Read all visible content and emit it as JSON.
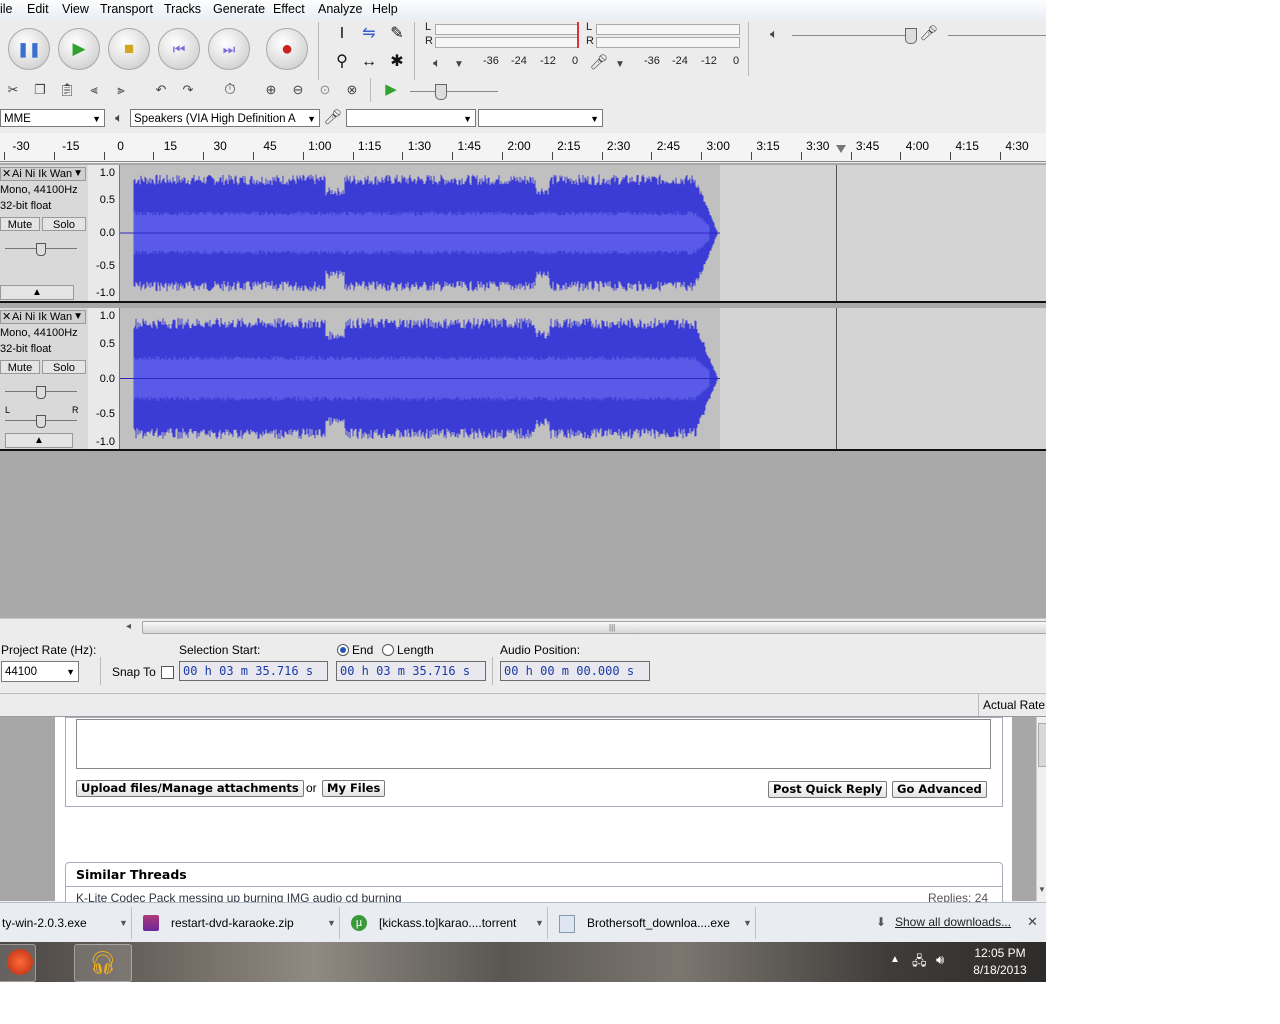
{
  "menu": [
    "ile",
    "Edit",
    "View",
    "Transport",
    "Tracks",
    "Generate",
    "Effect",
    "Analyze",
    "Help"
  ],
  "transport": {
    "buttons": [
      {
        "name": "pause-button",
        "icon": "pause-icon"
      },
      {
        "name": "play-button",
        "icon": "play-icon"
      },
      {
        "name": "stop-button",
        "icon": "stop-icon"
      },
      {
        "name": "skip-start-button",
        "icon": "skip-start-icon"
      },
      {
        "name": "skip-end-button",
        "icon": "skip-end-icon"
      },
      {
        "name": "record-button",
        "icon": "record-icon"
      }
    ]
  },
  "meters": {
    "playback_ticks": [
      "-36",
      "-24",
      "-12",
      "0"
    ],
    "record_ticks": [
      "-36",
      "-24",
      "-12",
      "0"
    ],
    "channel_l": "L",
    "channel_r": "R"
  },
  "devices": {
    "host": "MME",
    "output": "Speakers (VIA High Definition A",
    "input": "",
    "channels": ""
  },
  "timeline": {
    "ticks": [
      "-30",
      "-15",
      "0",
      "15",
      "30",
      "45",
      "1:00",
      "1:15",
      "1:30",
      "1:45",
      "2:00",
      "2:15",
      "2:30",
      "2:45",
      "3:00",
      "3:15",
      "3:30",
      "3:45",
      "4:00",
      "4:15",
      "4:30"
    ]
  },
  "tracks": [
    {
      "name": "Ai Ni Ik Wan",
      "format": "Mono, 44100Hz",
      "bits": "32-bit float",
      "mute": "Mute",
      "solo": "Solo",
      "scale": [
        "1.0",
        "0.5",
        "0.0",
        "-0.5",
        "-1.0"
      ]
    },
    {
      "name": "Ai Ni Ik Wan",
      "format": "Mono, 44100Hz",
      "bits": "32-bit float",
      "mute": "Mute",
      "solo": "Solo",
      "scale": [
        "1.0",
        "0.5",
        "0.0",
        "-0.5",
        "-1.0"
      ],
      "pan_left": "L",
      "pan_right": "R"
    }
  ],
  "selection": {
    "project_rate_label": "Project Rate (Hz):",
    "project_rate": "44100",
    "snap_to": "Snap To",
    "selection_start_label": "Selection Start:",
    "end_label": "End",
    "length_label": "Length",
    "audio_position_label": "Audio Position:",
    "start_value": "00 h 03 m 35.716 s",
    "end_value": "00 h 03 m 35.716 s",
    "position_value": "00 h 00 m 00.000 s",
    "end_selected": true
  },
  "status": {
    "actual_rate": "Actual Rate:"
  },
  "forum": {
    "upload_button": "Upload files/Manage attachments",
    "or": "or",
    "my_files": "My Files",
    "post_quick_reply": "Post Quick Reply",
    "go_advanced": "Go Advanced",
    "similar_threads": "Similar Threads",
    "thread_title": "K-Lite Codec Pack messing up burning IMG audio cd burning",
    "replies": "Replies: 24"
  },
  "downloads": {
    "items": [
      "ty-win-2.0.3.exe",
      "restart-dvd-karaoke.zip",
      "[kickass.to]karao....torrent",
      "Brothersoft_downloa....exe"
    ],
    "show_all": "Show all downloads..."
  },
  "taskbar": {
    "time": "12:05 PM",
    "date": "8/18/2013"
  },
  "colors": {
    "waveform": "#3b3bd6",
    "waveform_bg": "#c0c0c0",
    "time_digits": "#1a3aa8"
  }
}
